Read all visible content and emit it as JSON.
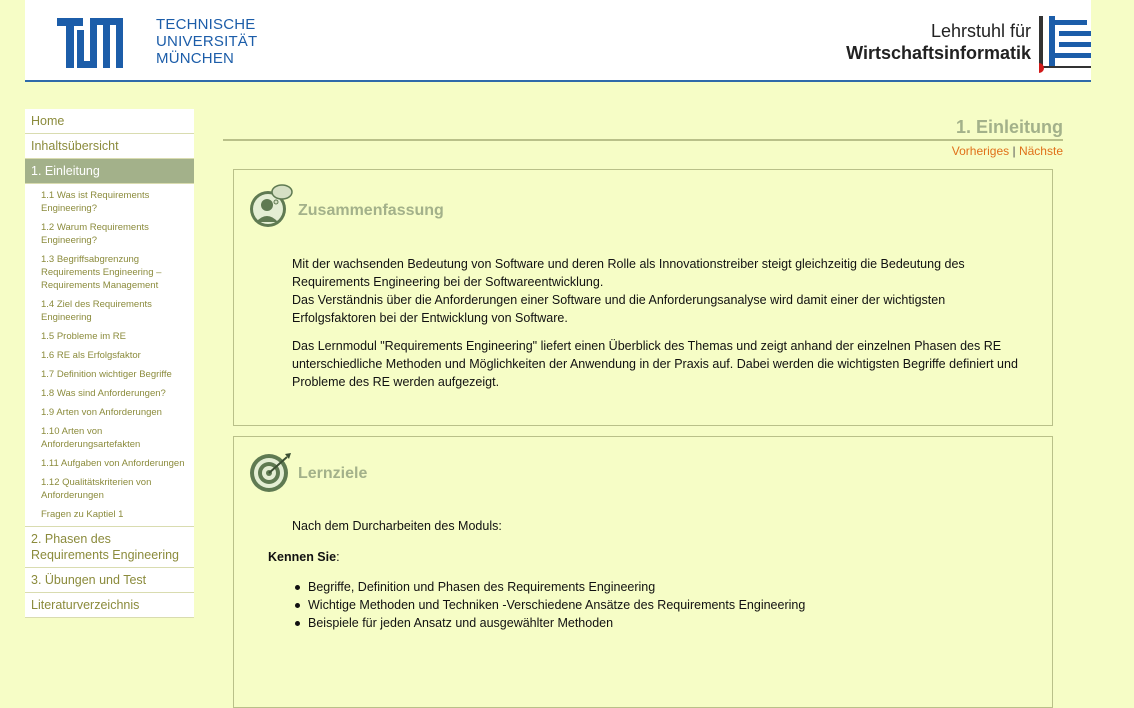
{
  "header": {
    "tum_lines": [
      "TECHNISCHE",
      "UNIVERSITÄT",
      "MÜNCHEN"
    ],
    "chair_line1": "Lehrstuhl für",
    "chair_line2": "Wirtschaftsinformatik"
  },
  "sidebar": {
    "home": "Home",
    "overview": "Inhaltsübersicht",
    "current": "1. Einleitung",
    "subitems": [
      "1.1 Was ist Requirements Engineering?",
      "1.2 Warum Requirements Engineering?",
      "1.3 Begriffsabgrenzung Requirements Engineering – Requirements Management",
      "1.4 Ziel des Requirements Engineering",
      "1.5 Probleme im RE",
      "1.6 RE als Erfolgsfaktor",
      "1.7 Definition wichtiger Begriffe",
      "1.8 Was sind Anforderungen?",
      "1.9 Arten von Anforderungen",
      "1.10 Arten von Anforderungsartefakten",
      "1.11 Aufgaben von Anforderungen",
      "1.12 Qualitätskriterien von Anforderungen",
      "Fragen zu Kaptiel 1"
    ],
    "chapter2": "2. Phasen des Requirements Engineering",
    "chapter3": "3. Übungen und Test",
    "literature": "Literaturverzeichnis"
  },
  "main": {
    "title": "1. Einleitung",
    "prev": "Vorheriges",
    "sep": "|",
    "next": "Nächste",
    "summary": {
      "title": "Zusammenfassung",
      "p1_l1": "Mit der wachsenden Bedeutung von Software und deren Rolle als Innovationstreiber steigt gleichzeitig die Bedeutung des",
      "p1_l2": "Requirements Engineering bei der Softwareentwicklung.",
      "p1_l3": "Das Verständnis über die Anforderungen einer Software und die Anforderungsanalyse wird damit einer der wichtigsten",
      "p1_l4": "Erfolgsfaktoren bei der Entwicklung von Software.",
      "p2_l1": "Das Lernmodul \"Requirements Engineering\" liefert einen Überblick des Themas und zeigt anhand der einzelnen Phasen des RE",
      "p2_l2": "unterschiedliche Methoden und Möglichkeiten der Anwendung in der Praxis auf. Dabei werden die wichtigsten Begriffe definiert und",
      "p2_l3": "Probleme des RE werden aufgezeigt."
    },
    "goals": {
      "title": "Lernziele",
      "intro": "Nach dem Durcharbeiten des Moduls:",
      "kennen": "Kennen Sie",
      "colon": ":",
      "items": [
        "Begriffe, Definition und Phasen des Requirements Engineering",
        "Wichtige Methoden und Techniken -Verschiedene Ansätze des Requirements Engineering",
        "Beispiele für jeden Ansatz und ausgewählter Methoden"
      ]
    }
  },
  "colors": {
    "accent": "#a3b18a",
    "link": "#e0701a",
    "background": "#f6fdc6",
    "tum_blue": "#1c5da9"
  }
}
